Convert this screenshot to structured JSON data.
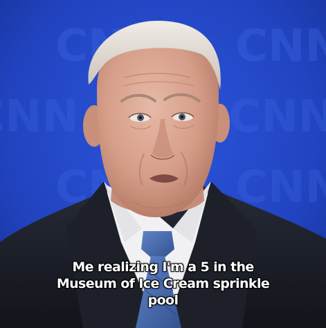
{
  "image": {
    "background_logo_text": "CNN",
    "background_color": "#2445c9",
    "suit_color": "#1b1e27",
    "tie_color": "#4a6fb4"
  },
  "caption": {
    "lines": [
      "Me realizing I'm a 5 in the",
      "Museum of Ice Cream sprinkle",
      "pool"
    ]
  }
}
